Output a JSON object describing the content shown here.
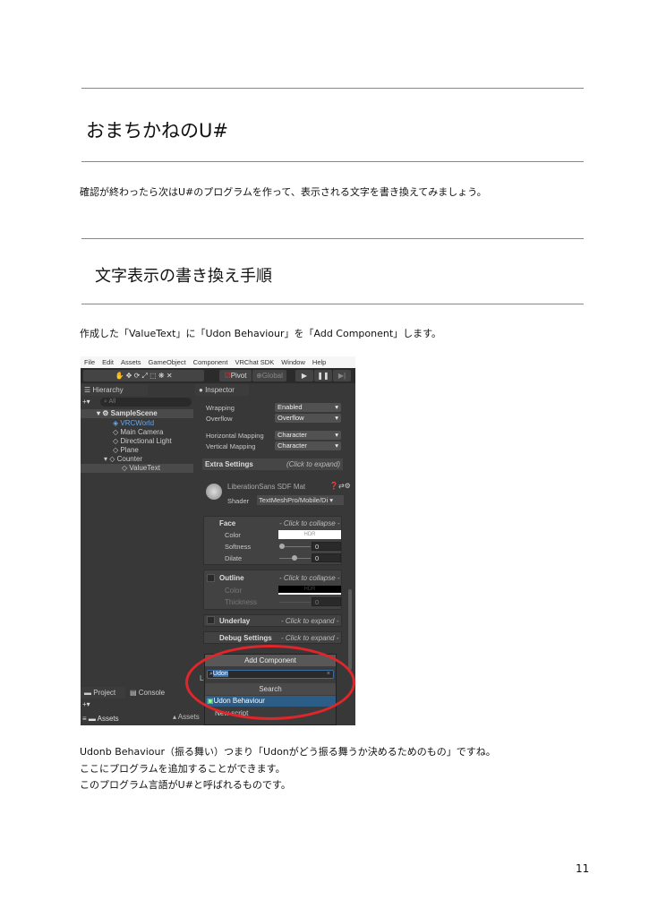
{
  "section1": {
    "title": "おまちかねのU#",
    "text": "確認が終わったら次はU#のプログラムを作って、表示される文字を書き換えてみましょう。"
  },
  "section2": {
    "title": "文字表示の書き換え手順",
    "text": "作成した「ValueText」に「Udon Behaviour」を「Add Component」します。"
  },
  "unity": {
    "menu": [
      "File",
      "Edit",
      "Assets",
      "GameObject",
      "Component",
      "VRChat SDK",
      "Window",
      "Help"
    ],
    "toolbar": {
      "pivot": "Pivot",
      "global": "Global"
    },
    "hierarchy": {
      "tab": "Hierarchy",
      "search_placeholder": "All",
      "items": [
        "SampleScene",
        "VRCWorld",
        "Main Camera",
        "Directional Light",
        "Plane",
        "Counter",
        "ValueText"
      ]
    },
    "inspector": {
      "tab": "Inspector",
      "wrapping_label": "Wrapping",
      "wrapping_value": "Enabled",
      "overflow_label": "Overflow",
      "overflow_value": "Overflow",
      "hmap_label": "Horizontal Mapping",
      "hmap_value": "Character",
      "vmap_label": "Vertical Mapping",
      "vmap_value": "Character",
      "extra_label": "Extra Settings",
      "extra_hint": "(Click to expand)",
      "material": "LiberationSans SDF Mat",
      "shader_label": "Shader",
      "shader_value": "TextMeshPro/Mobile/Di",
      "face": "Face",
      "collapse": "- Click to collapse -",
      "color": "Color",
      "hdr": "HDR",
      "softness": "Softness",
      "dilate": "Dilate",
      "zero": "0",
      "outline": "Outline",
      "thickness": "Thickness",
      "underlay": "Underlay",
      "expand": "- Click to expand -",
      "debug": "Debug Settings",
      "add_component": "Add Component",
      "search_value": "Udon",
      "search_header": "Search",
      "result": "Udon Behaviour",
      "new_script": "New script",
      "layer_hint": "La"
    },
    "bottom": {
      "project": "Project",
      "console": "Console",
      "assets_crumb": "Assets",
      "assets": "Assets"
    }
  },
  "paragraphs": [
    "Udonb Behaviour（振る舞い）つまり「Udonがどう振る舞うか決めるためのもの」ですね。",
    "ここにプログラムを追加することができます。",
    "このプログラム言語がU#と呼ばれるものです。"
  ],
  "page_number": "11",
  "colors": {
    "highlight": "#e0262b",
    "selection": "#2c5d87"
  }
}
